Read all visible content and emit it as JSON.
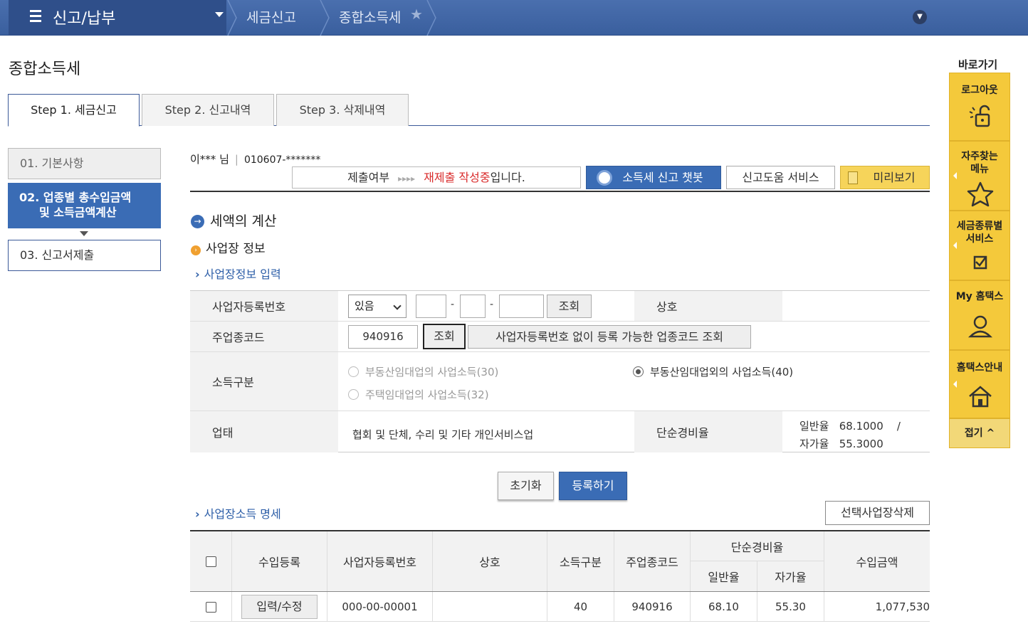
{
  "header": {
    "menu_title": "신고/납부",
    "crumb1": "세금신고",
    "crumb2": "종합소득세"
  },
  "page_title": "종합소득세",
  "tabs": [
    {
      "label": "Step 1. 세금신고"
    },
    {
      "label": "Step 2. 신고내역"
    },
    {
      "label": "Step 3. 삭제내역"
    }
  ],
  "steps": {
    "s1": "01. 기본사항",
    "s2_line1": "02. 업종별 총수입금액",
    "s2_line2": "및 소득금액계산",
    "s3": "03. 신고서제출"
  },
  "user": {
    "name": "이*** 님",
    "birth": "010607-*******"
  },
  "status": {
    "label": "제출여부",
    "arrows": "▸▸▸▸",
    "red": "재제출 작성중",
    "suffix": "입니다."
  },
  "buttons": {
    "chatbot": "소득세 신고 챗봇",
    "help": "신고도움 서비스",
    "preview": "미리보기"
  },
  "section": {
    "title": "세액의 계산",
    "subtitle": "사업장 정보",
    "input_heading": "사업장정보 입력",
    "list_heading": "사업장소득 명세"
  },
  "form": {
    "biz_no_label": "사업자등록번호",
    "biz_no_select": "있음",
    "biz_no_1": "",
    "biz_no_2": "",
    "biz_no_3": "",
    "lookup": "조회",
    "trade_name_label": "상호",
    "trade_name_value": "",
    "industry_code_label": "주업종코드",
    "industry_code_value": "940916",
    "industry_lookup": "조회",
    "industry_lookup_nobiz": "사업자등록번호 없이 등록 가능한 업종코드 조회",
    "income_type_label": "소득구분",
    "radio1": "부동산임대업의 사업소득(30)",
    "radio2": "부동산임대업외의 사업소득(40)",
    "radio3": "주택임대업의 사업소득(32)",
    "business_label": "업태",
    "business_value": "협회 및 단체, 수리 및 기타 개인서비스업",
    "expense_rate_label": "단순경비율",
    "general_rate_label": "일반율",
    "general_rate_value": "68.1000",
    "rate_sep": "/",
    "self_rate_label": "자가율",
    "self_rate_value": "55.3000"
  },
  "actions": {
    "reset": "초기화",
    "register": "등록하기",
    "delete_selected": "선택사업장삭제"
  },
  "table": {
    "headers": {
      "register": "수입등록",
      "biz_no": "사업자등록번호",
      "trade_name": "상호",
      "income_type": "소득구분",
      "industry_code": "주업종코드",
      "expense_rate": "단순경비율",
      "general_rate": "일반율",
      "self_rate": "자가율",
      "revenue": "수입금액"
    },
    "rows": [
      {
        "edit": "입력/수정",
        "biz_no": "000-00-00001",
        "trade_name": "",
        "income_type": "40",
        "industry_code": "940916",
        "general_rate": "68.10",
        "self_rate": "55.30",
        "revenue": "1,077,530"
      }
    ]
  },
  "quick": {
    "title": "바로가기",
    "logout": "로그아웃",
    "faq_line1": "자주찾는",
    "faq_line2": "메뉴",
    "tax_line1": "세금종류별",
    "tax_line2": "서비스",
    "myhometax": "My 홈택스",
    "guide": "홈택스안내",
    "collapse": "접기 ^"
  },
  "colors": {
    "header_bg": "#3a5f9e",
    "accent_blue": "#3a6cb5",
    "quick_yellow": "#f4c93b",
    "status_red": "#d92b2b"
  }
}
